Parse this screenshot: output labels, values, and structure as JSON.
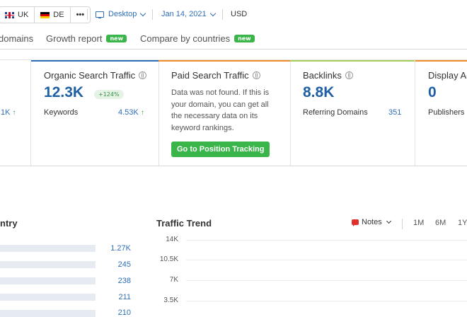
{
  "toolbar": {
    "databases": [
      {
        "code": "UK",
        "flag": "uk-flag-icon"
      },
      {
        "code": "DE",
        "flag": "de-flag-icon"
      }
    ],
    "more_label": "•••",
    "device": "Desktop",
    "date": "Jan 14, 2021",
    "currency": "USD"
  },
  "tabs": [
    {
      "label": "domains",
      "badge": ""
    },
    {
      "label": "Growth report",
      "badge": "new"
    },
    {
      "label": "Compare by countries",
      "badge": "new"
    }
  ],
  "cards": {
    "partial": {
      "value": "1K",
      "arrow": "↑"
    },
    "organic": {
      "title": "Organic Search Traffic",
      "value": "12.3K",
      "change": "+124%",
      "sub_label": "Keywords",
      "sub_value": "4.53K",
      "arrow": "↑",
      "accent": "#2d6fb8"
    },
    "paid": {
      "title": "Paid Search Traffic",
      "text": "Data was not found. If this is your domain, you can get all the necessary data on its keyword rankings.",
      "button": "Go to Position Tracking",
      "accent": "#f28c28"
    },
    "backlinks": {
      "title": "Backlinks",
      "value": "8.8K",
      "sub_label": "Referring Domains",
      "sub_value": "351",
      "accent": "#a8cf5a"
    },
    "display": {
      "title": "Display Ac",
      "value": "0",
      "sub_label": "Publishers",
      "accent": "#f28c28"
    }
  },
  "country_widget": {
    "title": "ntry",
    "values": [
      "1.27K",
      "245",
      "238",
      "211",
      "210"
    ]
  },
  "traffic_trend": {
    "title": "Traffic Trend",
    "notes": "Notes",
    "ranges": [
      "1M",
      "6M",
      "1Y"
    ],
    "y_ticks": [
      "14K",
      "10.5K",
      "7K",
      "3.5K"
    ]
  },
  "colors": {
    "link": "#2d6fb8",
    "green": "#3ab54a"
  }
}
